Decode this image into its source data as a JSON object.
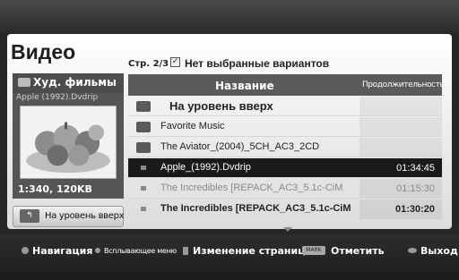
{
  "page": {
    "title": "Видео",
    "page_info": "Стр. 2/3",
    "no_selection": "Нет выбранные вариантов"
  },
  "preview": {
    "category": "Худ. фильмы",
    "file": "Apple (1992).Dvdrip",
    "resolution": "1:340, 120KB",
    "up_button_label": "На уровень вверх"
  },
  "list": {
    "headers": {
      "name": "Название",
      "duration": "Продолжительность"
    },
    "rows": [
      {
        "name": "На уровень вверх",
        "duration": "",
        "type": "up-folder"
      },
      {
        "name": "Favorite Music",
        "duration": "",
        "type": "folder"
      },
      {
        "name": "The Aviator_(2004)_5CH_AC3_2CD",
        "duration": "",
        "type": "folder"
      },
      {
        "name": "Apple_(1992).Dvdrip",
        "duration": "01:34:45",
        "type": "file"
      },
      {
        "name": "The Incredibles [REPACK_AC3_5.1c-CiM",
        "duration": "01:15:30",
        "type": "file"
      },
      {
        "name": "The Incredibles [REPACK_AC3_5.1c-CiM",
        "duration": "01:30:20",
        "type": "file"
      }
    ]
  },
  "bottom_bar": {
    "navigate": "Навигация",
    "popup_menu": "Всплывающее меню",
    "page_change": "Изменение страницы",
    "mark_key": "MARK",
    "mark": "Отметить",
    "exit": "Выход"
  }
}
